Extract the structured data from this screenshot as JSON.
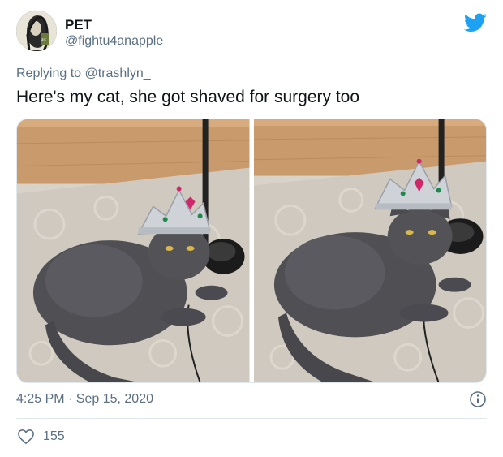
{
  "author": {
    "name": "PET",
    "handle": "@fightu4anapple",
    "avatar": "avatar-icon"
  },
  "reply": {
    "prefix": "Replying to ",
    "mention": "@trashlyn_"
  },
  "tweet": {
    "text": "Here's my cat, she got shaved for surgery too",
    "timestamp": "4:25 PM · Sep 15, 2020"
  },
  "media": {
    "photos": [
      "cat-wearing-tiara-photo-1",
      "cat-wearing-tiara-photo-2"
    ]
  },
  "engagement": {
    "likes": "155"
  },
  "icons": {
    "brand": "twitter-bird-icon",
    "info": "info-icon",
    "like": "heart-icon"
  },
  "colors": {
    "brand": "#1da1f2",
    "secondary_text": "#5b7083",
    "primary_text": "#0f1419",
    "divider": "#e1e8ed"
  }
}
